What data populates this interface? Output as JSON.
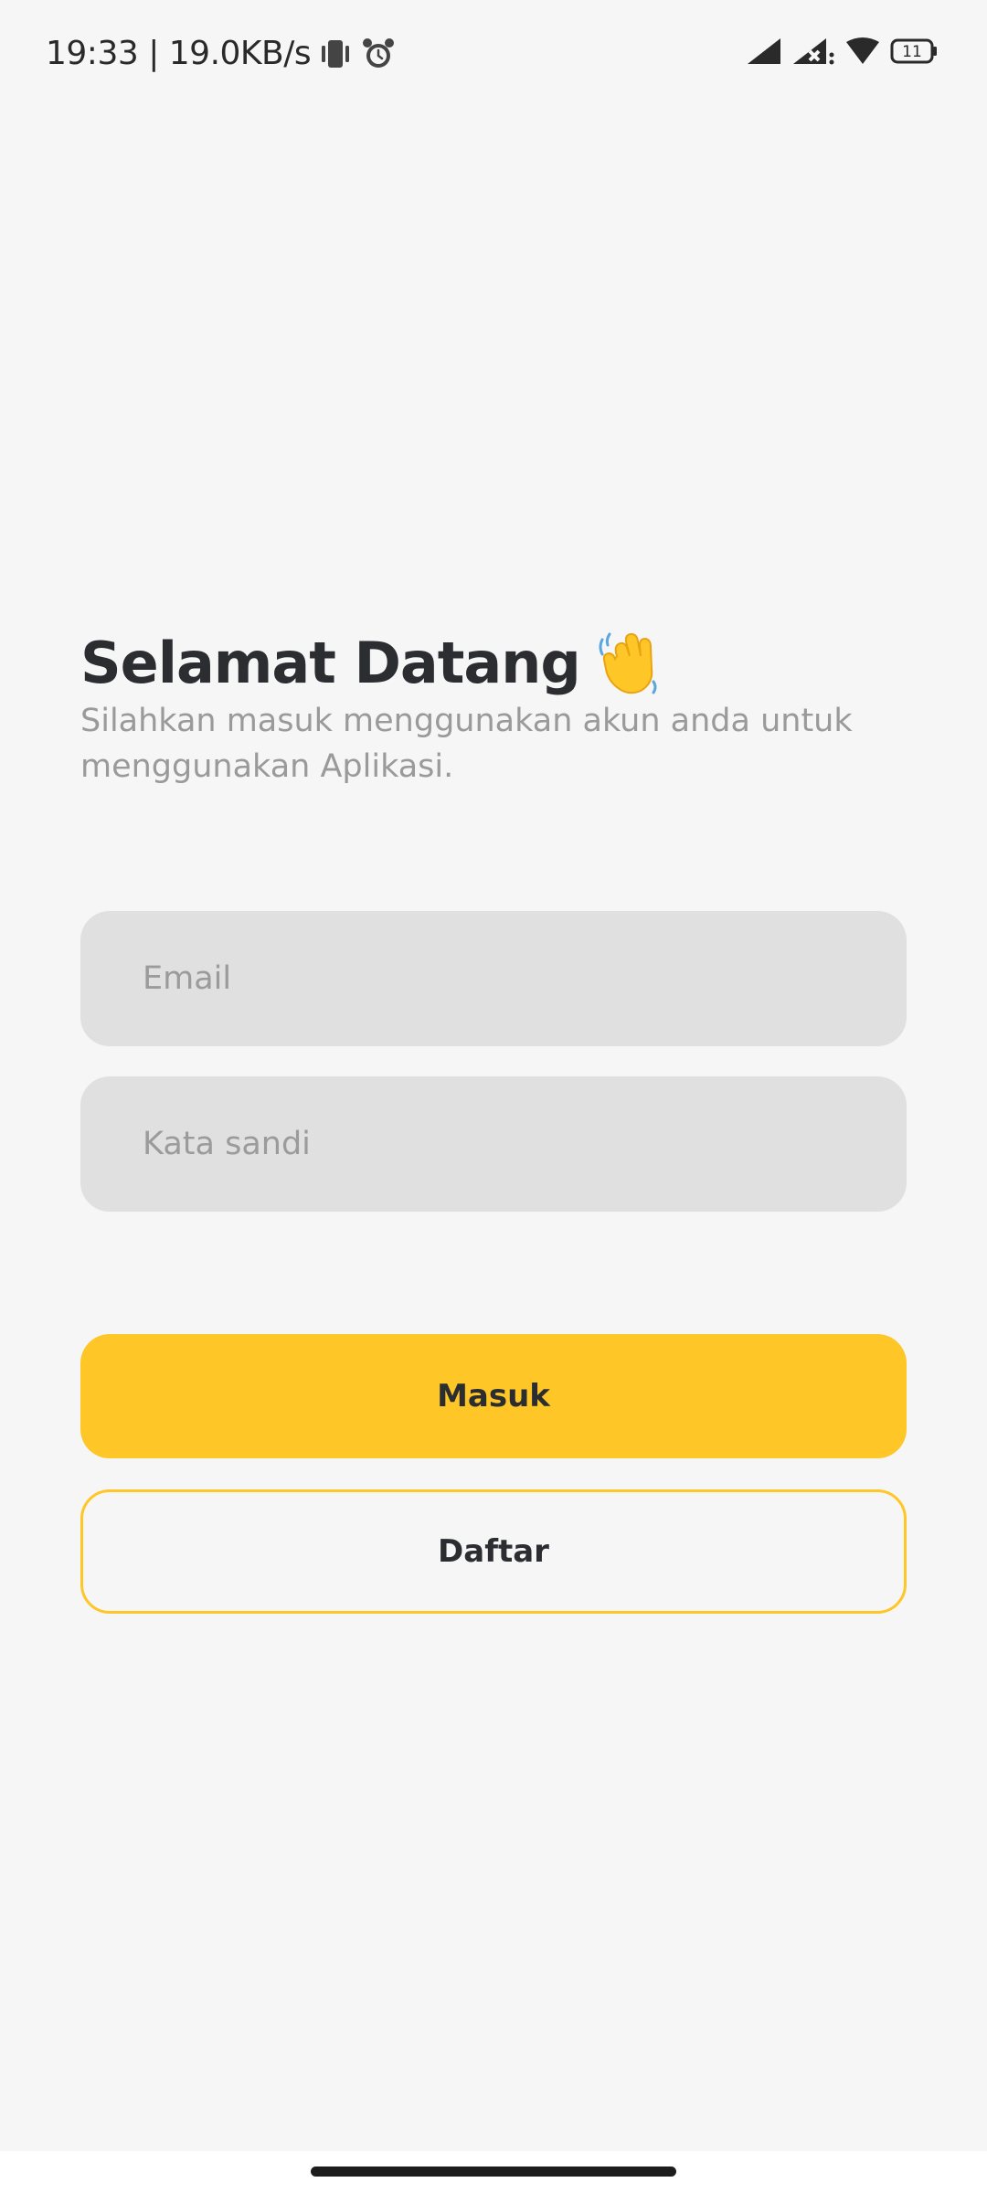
{
  "status_bar": {
    "time_speed": "19:33 | 19.0KB/s",
    "icons": [
      "vibrate-icon",
      "alarm-icon",
      "signal-icon",
      "signal-no-service-icon",
      "wifi-icon",
      "battery-icon"
    ],
    "battery_level": "11"
  },
  "greeting": {
    "title": "Selamat Datang",
    "emoji": "waving-hand-icon",
    "subtitle": "Silahkan masuk menggunakan akun anda untuk menggunakan Aplikasi."
  },
  "form": {
    "email": {
      "value": "",
      "placeholder": "Email"
    },
    "password": {
      "value": "",
      "placeholder": "Kata sandi"
    }
  },
  "actions": {
    "login_label": "Masuk",
    "register_label": "Daftar"
  },
  "colors": {
    "accent": "#ffc628",
    "background": "#f6f6f6",
    "input_bg": "#e0e0e0",
    "text_primary": "#2b2d31",
    "text_muted": "#9a9a9a"
  }
}
